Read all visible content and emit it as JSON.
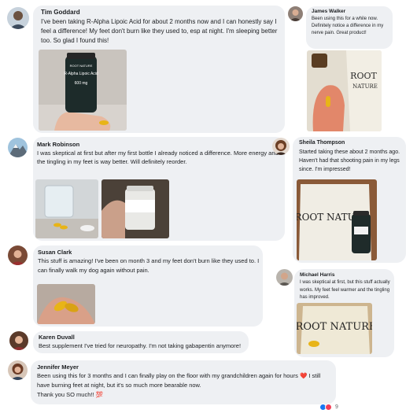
{
  "comments": [
    {
      "name": "Tim Goddard",
      "text": "I've been taking R-Alpha Lipoic Acid for about 2 months now and I can honestly say I feel a difference! My feet don't burn like they used to, esp at night. I'm sleeping better too. So glad I found this!",
      "bottle_brand": "ROOT NATURE",
      "bottle_label": "R-Alpha Lipoic Acid",
      "bottle_dose": "600 mg"
    },
    {
      "name": "James Walker",
      "text": "Been using this for a while now. Definitely notice a difference in my nerve pain. Great product!"
    },
    {
      "name": "Mark Robinson",
      "text": "I was skeptical at first but after my first bottle I already noticed a difference. More energy and the tingling in my feet is way better. Will definitely reorder."
    },
    {
      "name": "Sheila Thompson",
      "text": "Started taking these about 2 months ago. Haven't had that shooting pain in my legs since. I'm impressed!",
      "bag_brand": "ROOT NATURE"
    },
    {
      "name": "Susan Clark",
      "text": "This stuff is amazing! I've been on month 3 and my feet don't burn like they used to. I can finally walk my dog again without pain."
    },
    {
      "name": "Michael Harris",
      "text": "I was skeptical at first, but this stuff actually works. My feet feel warmer and the tingling has improved.",
      "bag_brand": "ROOT NATURE"
    },
    {
      "name": "Karen Duvall",
      "text": "Best supplement I've tried for neuropathy. I'm not taking gabapentin anymore!"
    },
    {
      "name": "Jennifer Meyer",
      "text_line1": "Been using this for 3 months and I can finally play on the floor with my grandchildren again for hours",
      "text_line2": "I still have burning feet at night, but it's so much more bearable now.",
      "text_line3": "Thank you SO much!!",
      "emoji_heart": "❤️",
      "emoji_100": "💯",
      "reaction_count": "9"
    }
  ],
  "colors": {
    "bubble": "#eef0f3",
    "like": "#1877f2",
    "love": "#f33e58",
    "capsule": "#e8b417"
  }
}
